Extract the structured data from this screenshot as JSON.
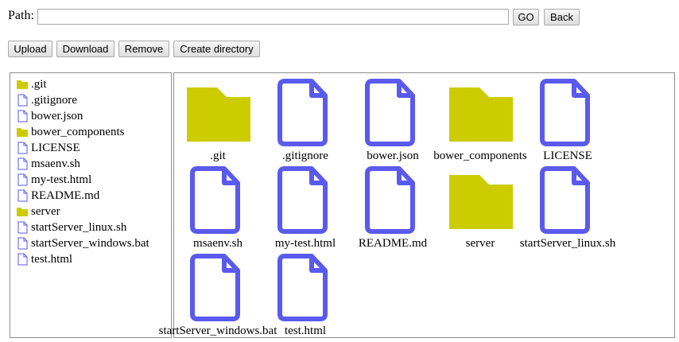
{
  "toolbar": {
    "path_label": "Path:",
    "path_value": "",
    "go_label": "GO",
    "back_label": "Back"
  },
  "actions": {
    "upload_label": "Upload",
    "download_label": "Download",
    "remove_label": "Remove",
    "create_dir_label": "Create directory"
  },
  "colors": {
    "folder": "#cccc00",
    "file": "#5a5aee"
  },
  "entries": [
    {
      "name": ".git",
      "type": "folder"
    },
    {
      "name": ".gitignore",
      "type": "file"
    },
    {
      "name": "bower.json",
      "type": "file"
    },
    {
      "name": "bower_components",
      "type": "folder"
    },
    {
      "name": "LICENSE",
      "type": "file"
    },
    {
      "name": "msaenv.sh",
      "type": "file"
    },
    {
      "name": "my-test.html",
      "type": "file"
    },
    {
      "name": "README.md",
      "type": "file"
    },
    {
      "name": "server",
      "type": "folder"
    },
    {
      "name": "startServer_linux.sh",
      "type": "file"
    },
    {
      "name": "startServer_windows.bat",
      "type": "file"
    },
    {
      "name": "test.html",
      "type": "file"
    }
  ]
}
